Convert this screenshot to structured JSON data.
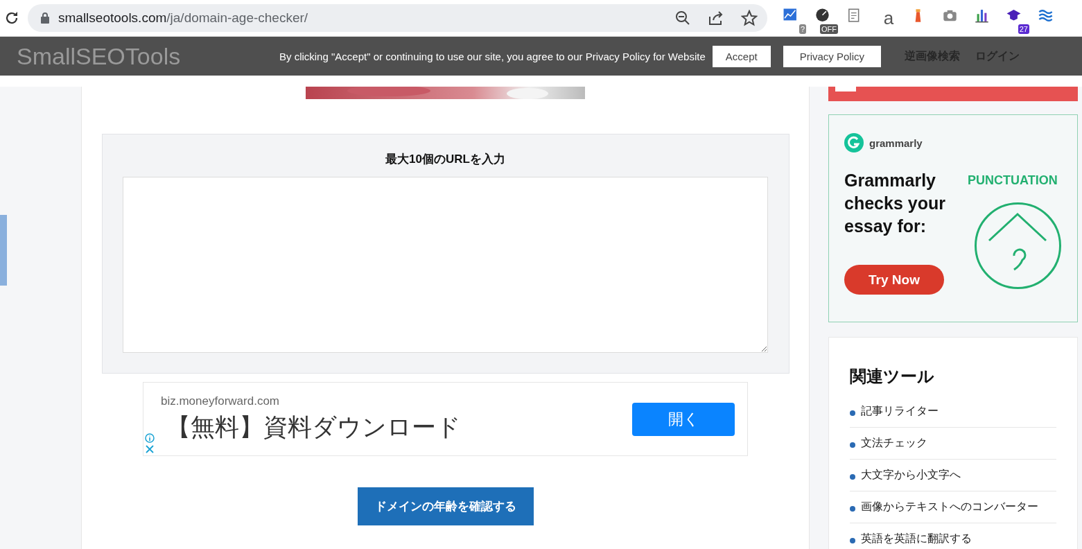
{
  "browser": {
    "url_host": "smallseotools.com",
    "url_path": "/ja/domain-age-checker/",
    "extensions": [
      {
        "kind": "chart",
        "badge": "?"
      },
      {
        "kind": "gauge",
        "badge": "OFF"
      },
      {
        "kind": "note"
      },
      {
        "kind": "letter",
        "glyph": "a"
      },
      {
        "kind": "lighthouse"
      },
      {
        "kind": "camera"
      },
      {
        "kind": "bars"
      },
      {
        "kind": "cap",
        "badge": "27"
      },
      {
        "kind": "waves"
      }
    ]
  },
  "header": {
    "logo": "SmallSEOTools",
    "nav": [
      "逆画像検索",
      "ログイン"
    ]
  },
  "cookie_bar": {
    "message": "By clicking \"Accept\" or continuing to use our site, you agree to our Privacy Policy for Website",
    "buttons": [
      "Accept",
      "Privacy Policy"
    ]
  },
  "url_form": {
    "title": "最大10個のURLを入力",
    "submit": "ドメインの年齢を確認する"
  },
  "ad": {
    "domain": "biz.moneyforward.com",
    "headline": "【無料】資料ダウンロード",
    "button": "開く"
  },
  "grammarly_ad": {
    "brand": "grammarly",
    "headline": "Grammarly checks your essay for:",
    "feature": "PUNCTUATION",
    "button": "Try Now"
  },
  "related_tools": {
    "title": "関連ツール",
    "items": [
      "記事リライター",
      "文法チェック",
      "大文字から小文字へ",
      "画像からテキストへのコンバーター",
      "英語を英語に翻訳する"
    ]
  }
}
